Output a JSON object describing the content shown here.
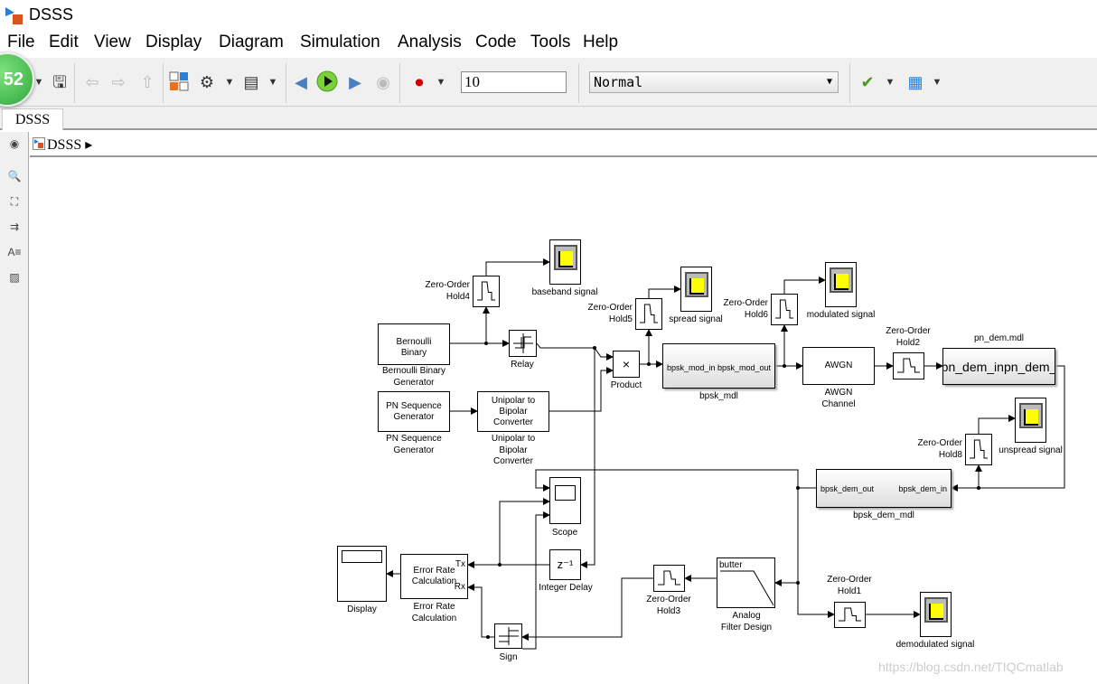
{
  "window": {
    "title": "DSSS"
  },
  "menu": [
    "File",
    "Edit",
    "View",
    "Display",
    "Diagram",
    "Simulation",
    "Analysis",
    "Code",
    "Tools",
    "Help"
  ],
  "toolbar": {
    "badge": "52",
    "stop_time": "10",
    "sim_mode": "Normal"
  },
  "tabs": [
    {
      "label": "DSSS"
    }
  ],
  "breadcrumb": {
    "model": "DSSS"
  },
  "blocks": {
    "bernoulli": {
      "text": "Bernoulli\nBinary",
      "label": "Bernoulli Binary\nGenerator"
    },
    "pn": {
      "text": "PN Sequence\nGenerator",
      "label": "PN Sequence\nGenerator"
    },
    "unipolar": {
      "text": "Unipolar to\nBipolar\nConverter",
      "label": "Unipolar to\nBipolar\nConverter"
    },
    "relay": {
      "label": "Relay"
    },
    "zoh4": {
      "label": "Zero-Order\nHold4"
    },
    "baseband": {
      "label": "baseband signal"
    },
    "product": {
      "text": "×",
      "label": "Product"
    },
    "zoh5": {
      "label": "Zero-Order\nHold5"
    },
    "spread": {
      "label": "spread signal"
    },
    "bpsk_mdl": {
      "text": "bpsk_mod_in bpsk_mod_out",
      "label": "bpsk_mdl"
    },
    "zoh6": {
      "label": "Zero-Order\nHold6"
    },
    "modulated": {
      "label": "modulated signal"
    },
    "awgn": {
      "text": "AWGN",
      "label": "AWGN\nChannel"
    },
    "zoh2": {
      "label": "Zero-Order\nHold2"
    },
    "pn_dem": {
      "text": "pn_dem_inpn_dem_",
      "label": "pn_dem.mdl"
    },
    "zoh8": {
      "label": "Zero-Order\nHold8"
    },
    "unspread": {
      "label": "unspread signal"
    },
    "bpsk_dem": {
      "in": "bpsk_dem_in",
      "out": "bpsk_dem_out",
      "label": "bpsk_dem_mdl"
    },
    "scope": {
      "label": "Scope"
    },
    "delay": {
      "text": "z⁻¹",
      "label": "Integer Delay"
    },
    "display": {
      "label": "Display"
    },
    "error_rate": {
      "text": "Error Rate\nCalculation",
      "tx": "Tx",
      "rx": "Rx",
      "label": "Error Rate\nCalculation"
    },
    "sign": {
      "label": "Sign"
    },
    "zoh3": {
      "label": "Zero-Order\nHold3"
    },
    "filter": {
      "text": "butter",
      "label": "Analog\nFilter Design"
    },
    "zoh1": {
      "label": "Zero-Order\nHold1"
    },
    "demodulated": {
      "label": "demodulated signal"
    }
  },
  "watermark": "https://blog.csdn.net/TIQCmatlab"
}
